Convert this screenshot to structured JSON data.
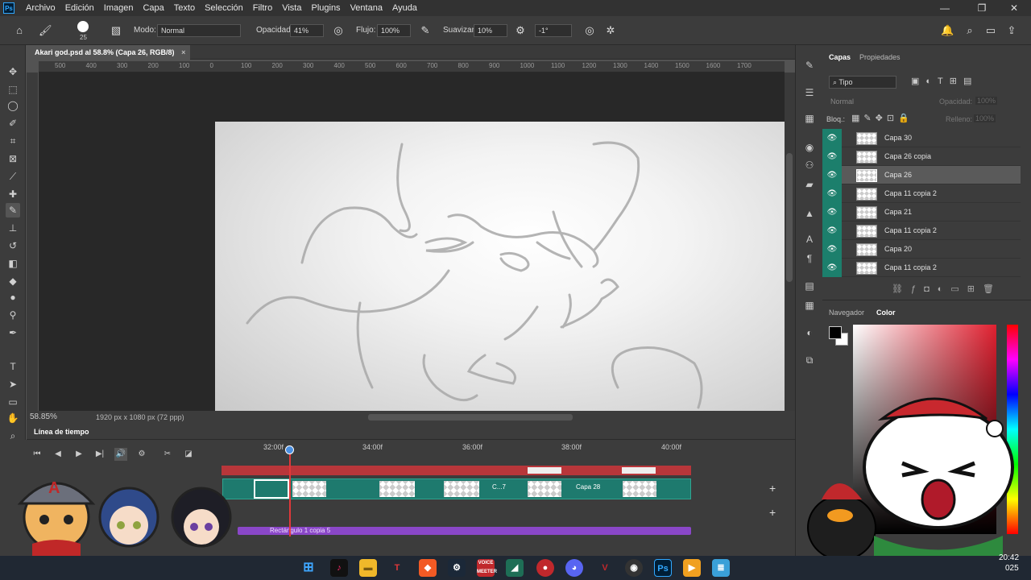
{
  "app": {
    "logo": "Ps"
  },
  "menu": [
    "Archivo",
    "Edición",
    "Imagen",
    "Capa",
    "Texto",
    "Selección",
    "Filtro",
    "Vista",
    "Plugins",
    "Ventana",
    "Ayuda"
  ],
  "window_controls": {
    "minimize": "—",
    "restore": "❐",
    "close": "✕"
  },
  "options": {
    "brush_size": "25",
    "mode_label": "Modo:",
    "mode_value": "Normal",
    "opacity_label": "Opacidad:",
    "opacity_value": "41%",
    "flow_label": "Flujo:",
    "flow_value": "100%",
    "smooth_label": "Suavizar:",
    "smooth_value": "10%",
    "angle_value": "-1°"
  },
  "document": {
    "tab_title": "Akari god.psd al 58.8% (Capa 26, RGB/8)",
    "tab_close": "×",
    "zoom": "58.85%",
    "dimensions": "1920 px x 1080 px (72 ppp)"
  },
  "ruler_top": [
    "500",
    "400",
    "300",
    "200",
    "100",
    "0",
    "100",
    "200",
    "300",
    "400",
    "500",
    "600",
    "700",
    "800",
    "900",
    "1000",
    "1100",
    "1200",
    "1300",
    "1400",
    "1500",
    "1600",
    "1700"
  ],
  "timeline": {
    "title": "Línea de tiempo",
    "frames": [
      "32:00f",
      "34:00f",
      "36:00f",
      "38:00f",
      "40:00f"
    ],
    "clip_labels": [
      "C...7",
      "Capa 28"
    ],
    "bottom_track": "Rectángulo 1 copia 5",
    "add_button": "+"
  },
  "layers_panel": {
    "tab_layers": "Capas",
    "tab_properties": "Propiedades",
    "filter_label": "Tipo",
    "blend_mode": "Normal",
    "opacity_label": "Opacidad:",
    "opacity_value": "100%",
    "lock_label": "Bloq.:",
    "fill_label": "Relleno:",
    "fill_value": "100%",
    "layers": [
      {
        "name": "Capa 30",
        "selected": false
      },
      {
        "name": "Capa 26 copia",
        "selected": false
      },
      {
        "name": "Capa 26",
        "selected": true
      },
      {
        "name": "Capa 11 copia 2",
        "selected": false
      },
      {
        "name": "Capa 21",
        "selected": false
      },
      {
        "name": "Capa 11 copia 2",
        "selected": false
      },
      {
        "name": "Capa 20",
        "selected": false
      },
      {
        "name": "Capa 11 copia 2",
        "selected": false
      }
    ]
  },
  "color_panel": {
    "tab_navigator": "Navegador",
    "tab_color": "Color"
  },
  "taskbar": {
    "time": "20:42",
    "date_partial": "025",
    "voice_app": "VOICE MEETER"
  },
  "colors": {
    "accent_teal": "#1c7f6c",
    "playhead_red": "#e0383a",
    "track_red": "#b8363a",
    "track_purple": "#8a47c8",
    "ps_blue": "#31a8ff"
  }
}
